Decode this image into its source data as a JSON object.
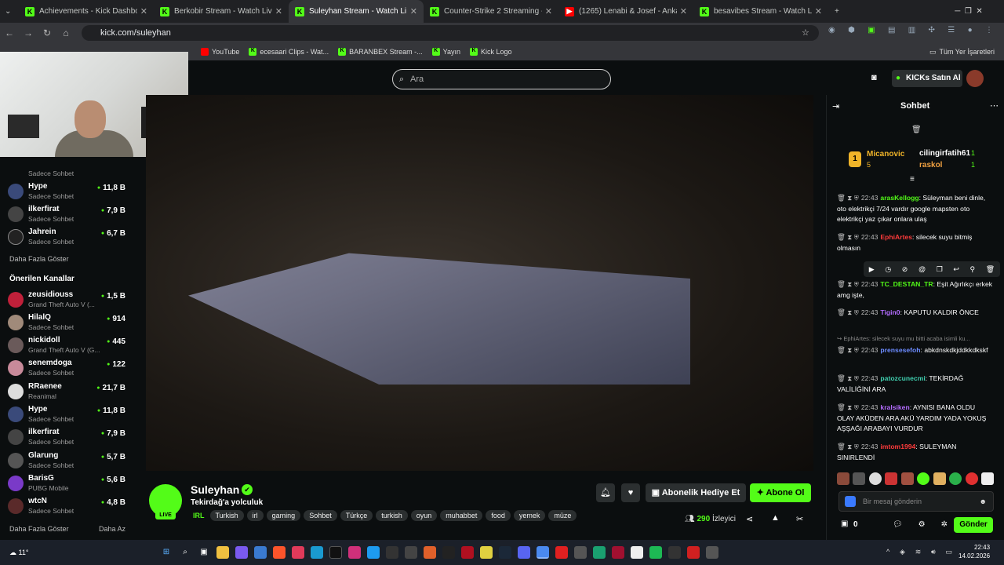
{
  "browser": {
    "tabs": [
      {
        "title": "Achievements - Kick Dashboard",
        "icon": "kick"
      },
      {
        "title": "Berkobir Stream - Watch Live o",
        "icon": "kick"
      },
      {
        "title": "Suleyhan Stream - Watch Li",
        "icon": "kick",
        "active": true
      },
      {
        "title": "Counter-Strike 2 Streaming - Li",
        "icon": "kick"
      },
      {
        "title": "(1265) Lenabi & Josef - Ankara",
        "icon": "youtube"
      },
      {
        "title": "besavibes Stream - Watch Live",
        "icon": "kick"
      }
    ],
    "url": "kick.com/suleyhan",
    "bookmarks": [
      {
        "label": "YouTube",
        "icon": "youtube"
      },
      {
        "label": "ecesaari Clips - Wat...",
        "icon": "kick"
      },
      {
        "label": "BARANBEX Stream -...",
        "icon": "kick"
      },
      {
        "label": "Yayın",
        "icon": "kick"
      },
      {
        "label": "Kick Logo",
        "icon": "kick"
      }
    ],
    "bookmarks_right": "Tüm Yer İşaretleri"
  },
  "header": {
    "search_placeholder": "Ara",
    "kicks_button": "KICKs Satın Al"
  },
  "sidebar": {
    "followed": [
      {
        "name": "",
        "category": "Sadece Sohbet",
        "viewers": ""
      },
      {
        "name": "Hype",
        "category": "Sadece Sohbet",
        "viewers": "11,8 B"
      },
      {
        "name": "ilkerfirat",
        "category": "Sadece Sohbet",
        "viewers": "7,9 B"
      },
      {
        "name": "Jahrein",
        "category": "Sadece Sohbet",
        "viewers": "6,7 B"
      }
    ],
    "show_more": "Daha Fazla Göster",
    "recommended_title": "Önerilen Kanallar",
    "recommended": [
      {
        "name": "zeusidiouss",
        "category": "Grand Theft Auto V (...",
        "viewers": "1,5 B"
      },
      {
        "name": "HilalQ",
        "category": "Sadece Sohbet",
        "viewers": "914"
      },
      {
        "name": "nickidoll",
        "category": "Grand Theft Auto V (G...",
        "viewers": "445"
      },
      {
        "name": "senemdoga",
        "category": "Sadece Sohbet",
        "viewers": "122"
      },
      {
        "name": "RRaenee",
        "category": "Reanimal",
        "viewers": "21,7 B"
      },
      {
        "name": "Hype",
        "category": "Sadece Sohbet",
        "viewers": "11,8 B"
      },
      {
        "name": "ilkerfirat",
        "category": "Sadece Sohbet",
        "viewers": "7,9 B"
      },
      {
        "name": "Glarung",
        "category": "Sadece Sohbet",
        "viewers": "5,7 B"
      },
      {
        "name": "BarisG",
        "category": "PUBG Mobile",
        "viewers": "5,6 B"
      },
      {
        "name": "wtcN",
        "category": "Sadece Sohbet",
        "viewers": "4,8 B"
      }
    ],
    "show_more_2": "Daha Fazla Göster",
    "show_less": "Daha Az"
  },
  "stream": {
    "streamer": "Suleyhan",
    "title": "Tekirdağ'a yolculuk",
    "live_label": "LIVE",
    "category": "IRL",
    "tags": [
      "Turkish",
      "irl",
      "gaming",
      "Sohbet",
      "Türkçe",
      "turkish",
      "oyun",
      "muhabbet",
      "food",
      "yemek",
      "müze"
    ],
    "gift_sub_label": "Abonelik Hediye Et",
    "subscribe_label": "Abone Ol",
    "viewers": "290",
    "viewers_label": "İzleyici"
  },
  "chat": {
    "title": "Sohbet",
    "top_gifters": [
      {
        "name": "Micanovic",
        "count": "5",
        "rank": "1"
      },
      {
        "name": "cilingirfatih61",
        "count": "1"
      },
      {
        "name": "raskol",
        "count": "1"
      }
    ],
    "messages": [
      {
        "time": "22:43",
        "user": "arasKellogg",
        "color": "green",
        "text": "Süleyman beni dinle, oto elektrikçi 7/24 vardır google mapsten oto elektrikçi yaz çıkar onlara ulaş"
      },
      {
        "time": "22:43",
        "user": "EphiArtes",
        "color": "red",
        "text": "silecek suyu bitmiş olmasın"
      },
      {
        "time": "22:43",
        "user": "TC_DESTAN_TR",
        "color": "green",
        "text": "Eşit Ağırlıkçı erkek amg işte,"
      },
      {
        "time": "22:43",
        "user": "Tigin0",
        "color": "purple",
        "text": "KAPUTU KALDIR ÖNCE"
      },
      {
        "time": "",
        "user": "",
        "color": "",
        "text": "EphiArtes: silecek suyu mu bitti acaba isimli ku..."
      },
      {
        "time": "22:43",
        "user": "prensesefoh",
        "color": "blue",
        "text": "abkdnskdkjddkkdkskf"
      },
      {
        "time": "22:43",
        "user": "patozcunecmi",
        "color": "teal",
        "text": "TEKİRDAĞ VALİLİĞİNİ ARA"
      },
      {
        "time": "22:43",
        "user": "kralsiken",
        "color": "purple",
        "text": "AYNISI BANA OLDU OLAY AKÜDEN ARA AKÜ YARDIM YADA YOKUŞ AŞŞAĞI ARABAYI VURDUR"
      },
      {
        "time": "22:43",
        "user": "imtom1994",
        "color": "red",
        "text": "SULEYMAN SINIRLENDİ"
      }
    ],
    "input_placeholder": "Bir mesaj gönderin",
    "send_label": "Gönder",
    "points": "0"
  },
  "taskbar": {
    "weather": "11°",
    "time": "22:43",
    "date": "14.02.2026"
  }
}
